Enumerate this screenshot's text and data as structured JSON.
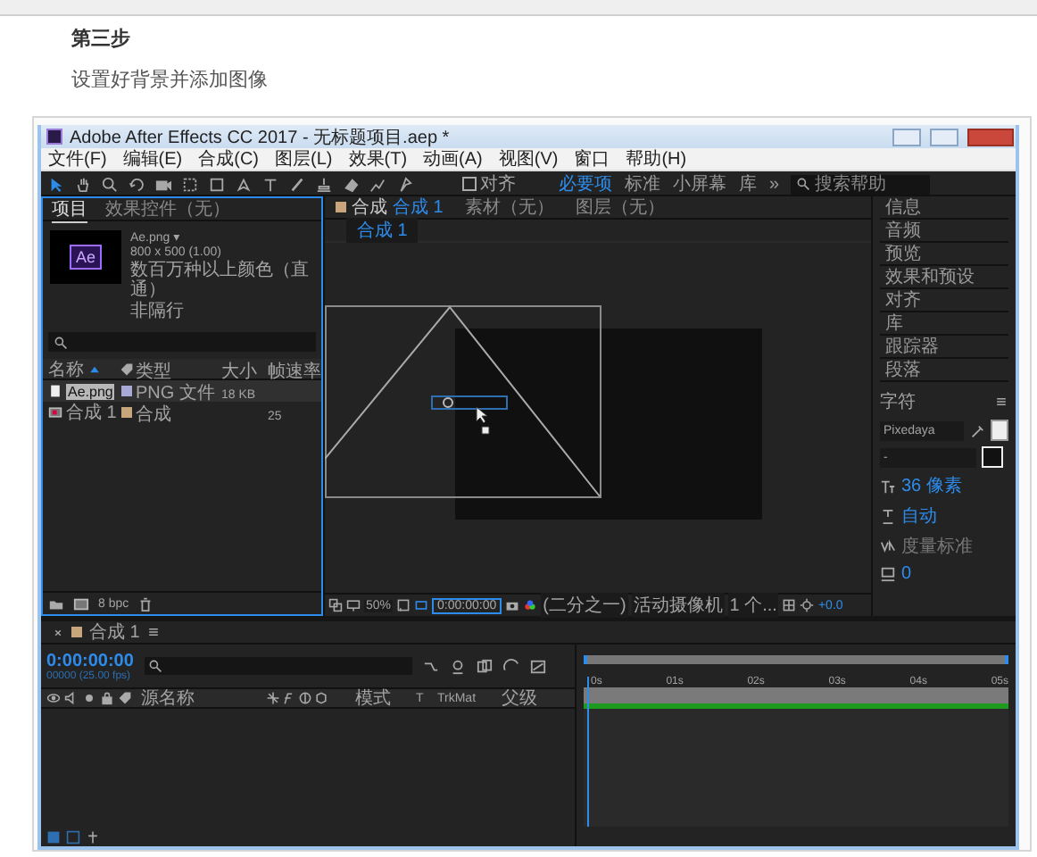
{
  "article": {
    "step_title": "第三步",
    "description": "设置好背景并添加图像"
  },
  "window": {
    "title": "Adobe After Effects CC 2017 - 无标题项目.aep *"
  },
  "menu": [
    "文件(F)",
    "编辑(E)",
    "合成(C)",
    "图层(L)",
    "效果(T)",
    "动画(A)",
    "视图(V)",
    "窗口",
    "帮助(H)"
  ],
  "toolbar": {
    "snap": {
      "label": "对齐",
      "checked": false
    },
    "workspaces": [
      {
        "label": "必要项",
        "selected": true
      },
      {
        "label": "标准",
        "selected": false
      },
      {
        "label": "小屏幕",
        "selected": false
      },
      {
        "label": "库",
        "selected": false
      }
    ],
    "overflow": "»",
    "search": {
      "placeholder": "搜索帮助"
    }
  },
  "project": {
    "tabs": [
      {
        "label": "项目",
        "selected": true
      },
      {
        "label": "效果控件（无）",
        "selected": false
      }
    ],
    "preview": {
      "thumbnail_label": "Ae",
      "name": "Ae.png ▾",
      "dimensions": "800 x 500 (1.00)",
      "color_depth": "数百万种以上颜色（直通）",
      "field_order": "非隔行"
    },
    "columns": [
      "名称",
      "类型",
      "大小",
      "帧速率"
    ],
    "rows": [
      {
        "kind": "footage",
        "name": "Ae.png",
        "type": "PNG 文件",
        "size": "18 KB",
        "color": "#a9a9d6",
        "selected": true
      },
      {
        "kind": "composition",
        "name": "合成 1",
        "type": "合成",
        "frame_rate": "25",
        "color": "#c8a67c",
        "selected": false
      }
    ],
    "bit_depth": "8 bpc"
  },
  "viewer": {
    "tabs": [
      {
        "label": "合成",
        "name": "合成 1",
        "selected": true
      },
      {
        "label": "素材（无）",
        "selected": false
      },
      {
        "label": "图层（无）",
        "selected": false
      }
    ],
    "breadcrumb": "合成 1",
    "zoom": "50%",
    "timecode": "0:00:00:00",
    "resolution": "(二分之一)",
    "camera": "活动摄像机",
    "views": "1 个...",
    "exposure": "+0.0"
  },
  "side": {
    "panels": [
      "信息",
      "音频",
      "预览",
      "效果和预设",
      "对齐",
      "库",
      "跟踪器",
      "段落"
    ],
    "character": {
      "title": "字符",
      "font": "Pixedaya",
      "style": "-",
      "size": "36 像素",
      "leading": "自动",
      "kerning": "度量标准",
      "tracking": "0"
    }
  },
  "timeline": {
    "tab": "合成 1",
    "timecode": "0:00:00:00",
    "frame_info": "00000 (25.00 fps)",
    "columns": [
      "源名称",
      "模式",
      "T",
      "TrkMat",
      "父级"
    ],
    "ruler": [
      "0s",
      "01s",
      "02s",
      "03s",
      "04s",
      "05s"
    ]
  }
}
